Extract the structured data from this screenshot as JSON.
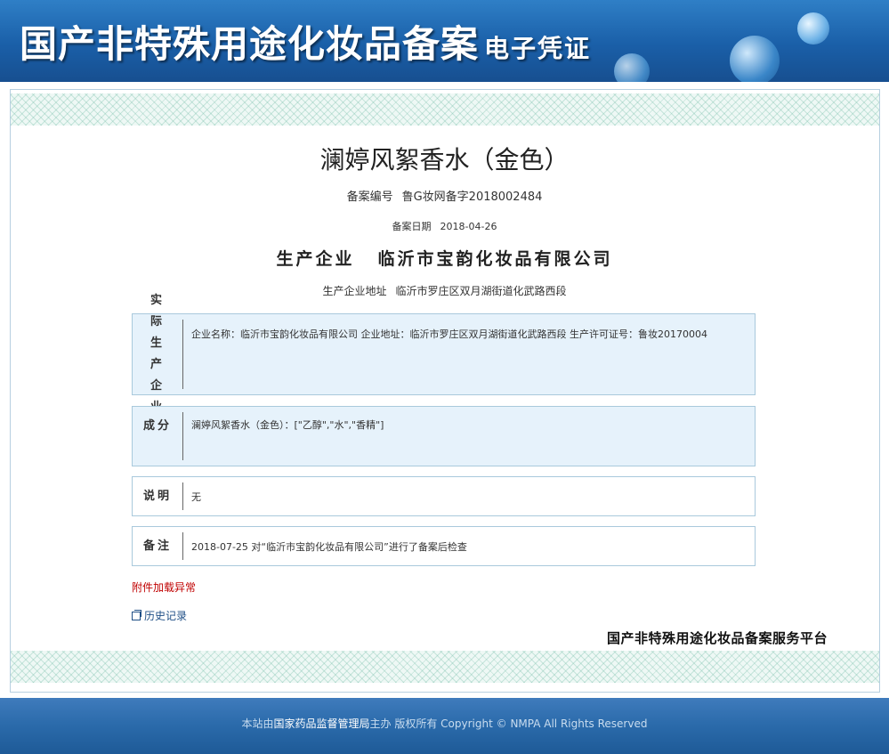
{
  "header": {
    "title": "国产非特殊用途化妆品备案",
    "subtitle": "电子凭证"
  },
  "product": {
    "name": "澜婷风絮香水（金色）",
    "reg_no_label": "备案编号",
    "reg_no": "鲁G妆网备字2018002484",
    "reg_date_label": "备案日期",
    "reg_date": "2018-04-26",
    "producer_label": "生产企业",
    "producer": "临沂市宝韵化妆品有限公司",
    "producer_addr_label": "生产企业地址",
    "producer_addr": "临沂市罗庄区双月湖街道化武路西段"
  },
  "sections": {
    "actual": {
      "label": "实际生产企业",
      "content": "企业名称：临沂市宝韵化妆品有限公司    企业地址：临沂市罗庄区双月湖街道化武路西段    生产许可证号：鲁妆20170004"
    },
    "ingredients": {
      "label": "成分",
      "content": "澜婷风絮香水（金色）：[\"乙醇\",\"水\",\"香精\"]"
    },
    "notes": {
      "label": "说明",
      "content": "无"
    },
    "remarks": {
      "label": "备注",
      "content": "2018-07-25 对“临沂市宝韵化妆品有限公司”进行了备案后检查"
    }
  },
  "attachment_error": "附件加载异常",
  "history_link": "历史记录",
  "platform_name": "国产非特殊用途化妆品备案服务平台",
  "footer": {
    "prefix": "本站由",
    "org": "国家药品监督管理局",
    "suffix": "主办 版权所有 Copyright © NMPA All Rights Reserved"
  }
}
